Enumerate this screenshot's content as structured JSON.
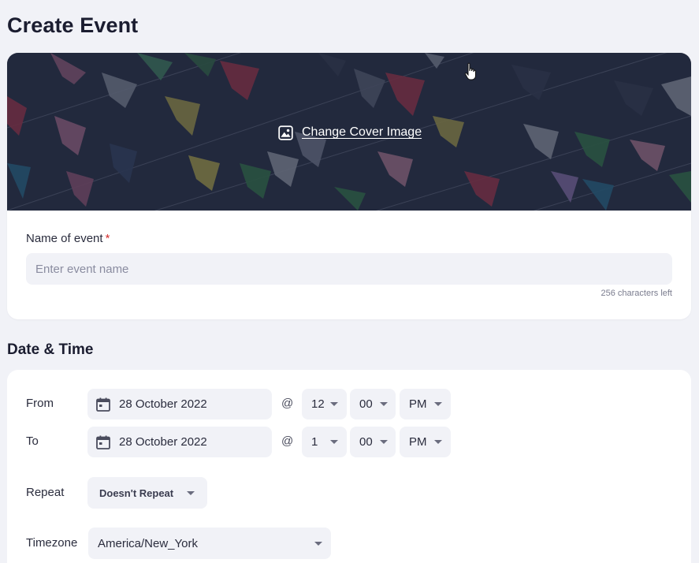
{
  "page": {
    "title": "Create Event"
  },
  "cover": {
    "change_label": "Change Cover Image"
  },
  "event_name": {
    "label": "Name of event",
    "required_mark": "*",
    "placeholder": "Enter event name",
    "value": "",
    "chars_left": "256 characters left"
  },
  "datetime": {
    "section_title": "Date & Time",
    "at_symbol": "@",
    "from": {
      "label": "From",
      "date": "28 October 2022",
      "hour": "12",
      "minute": "00",
      "ampm": "PM"
    },
    "to": {
      "label": "To",
      "date": "28 October 2022",
      "hour": "1",
      "minute": "00",
      "ampm": "PM"
    },
    "repeat": {
      "label": "Repeat",
      "value": "Doesn't Repeat"
    },
    "timezone": {
      "label": "Timezone",
      "value": "America/New_York"
    }
  },
  "icons": {
    "cover": "image-icon",
    "calendar": "calendar-icon",
    "dropdown": "caret-down-icon",
    "cursor": "hand-pointer-icon"
  },
  "colors": {
    "background": "#f1f2f7",
    "card": "#ffffff",
    "field": "#f1f2f7",
    "required": "#d32f2f",
    "title": "#1b1d30",
    "cover_overlay": "#1c2238"
  }
}
